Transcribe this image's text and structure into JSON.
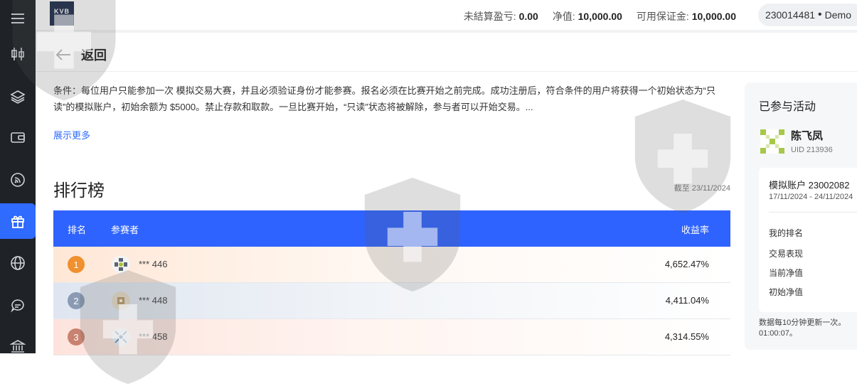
{
  "sidebar": {
    "items": [
      {
        "name": "menu-icon",
        "active": false
      },
      {
        "name": "candlestick-icon",
        "active": false
      },
      {
        "name": "layers-icon",
        "active": false
      },
      {
        "name": "wallet-icon",
        "active": false
      },
      {
        "name": "rss-icon",
        "active": false
      },
      {
        "name": "gift-icon",
        "active": true
      },
      {
        "name": "globe-icon",
        "active": false
      },
      {
        "name": "chat-icon",
        "active": false
      },
      {
        "name": "bank-icon",
        "active": false
      }
    ]
  },
  "header": {
    "logo_text": "KVB",
    "unrealized_label": "未結算盈亏:",
    "unrealized_value": "0.00",
    "equity_label": "净值:",
    "equity_value": "10,000.00",
    "margin_label": "可用保证金:",
    "margin_value": "10,000.00",
    "account_number": "230014481",
    "account_type": "Demo"
  },
  "page": {
    "back_label": "返回",
    "conditions": "条件：每位用户只能参加一次 模拟交易大赛，并且必须验证身份才能参赛。报名必须在比赛开始之前完成。成功注册后，符合条件的用户将获得一个初始状态为“只读”的模拟账户，初始余额为 $5000。禁止存款和取款。一旦比赛开始，“只读”状态将被解除，参与者可以开始交易。...",
    "show_more": "展示更多"
  },
  "leaderboard": {
    "title": "排行榜",
    "as_of": "截至 23/11/2024",
    "col_rank": "排名",
    "col_participant": "参赛者",
    "col_return": "收益率",
    "rows": [
      {
        "rank": "1",
        "name": "*** 446",
        "return": "4,652.47%",
        "badge_color": "#f0902e"
      },
      {
        "rank": "2",
        "name": "*** 448",
        "return": "4,411.04%",
        "badge_color": "#8a9bb3"
      },
      {
        "rank": "3",
        "name": "*** 458",
        "return": "4,314.55%",
        "badge_color": "#c98270"
      }
    ]
  },
  "side_card": {
    "title": "已参与活动",
    "user_name": "陈飞凤",
    "user_uid": "UID 213936",
    "account_name": "模拟账户 23002082",
    "account_dates": "17/11/2024 - 24/11/2024",
    "metrics": [
      "我的排名",
      "交易表现",
      "当前净值",
      "初始净值"
    ],
    "note": "数据每10分钟更新一次。01:00:07。"
  },
  "colors": {
    "accent": "#2f63ff",
    "sidebar_bg": "#1f2226"
  }
}
